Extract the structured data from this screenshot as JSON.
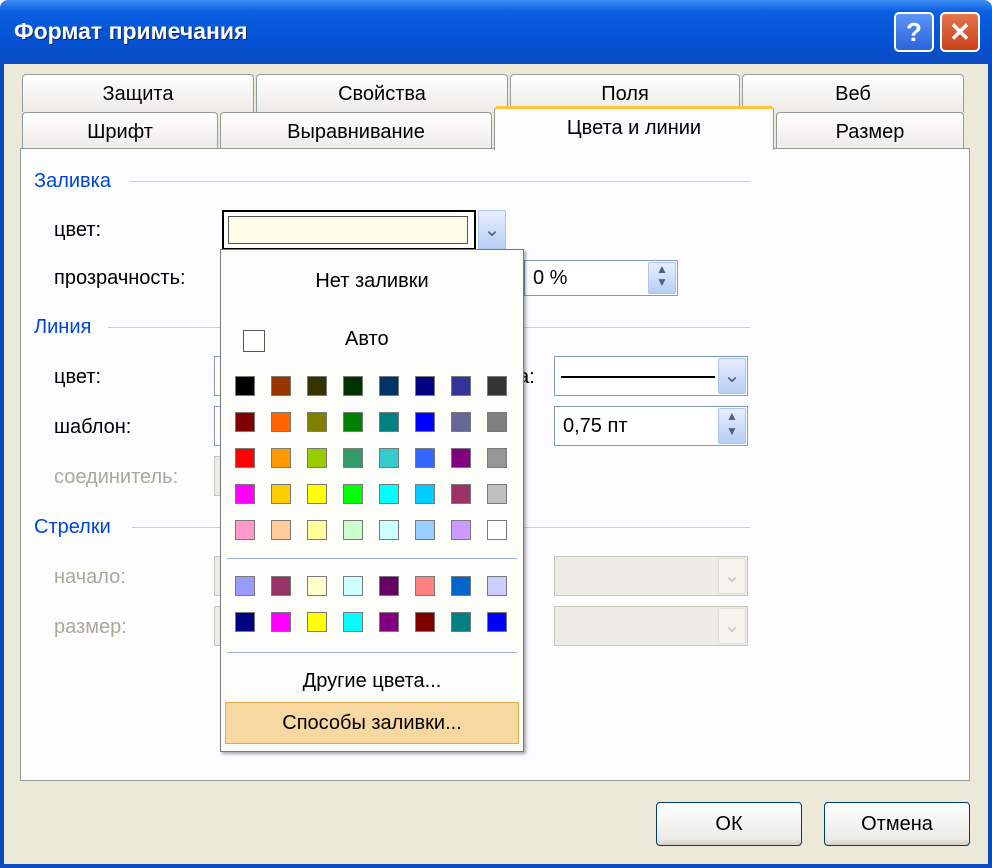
{
  "window": {
    "title": "Формат примечания",
    "help_symbol": "?",
    "close_symbol": "✕"
  },
  "tabs": {
    "back": [
      "Защита",
      "Свойства",
      "Поля",
      "Веб"
    ],
    "front": [
      "Шрифт",
      "Выравнивание",
      "Цвета и линии",
      "Размер"
    ],
    "active": "Цвета и линии"
  },
  "fill": {
    "group": "Заливка",
    "color_label": "цвет:",
    "transparency_label": "прозрачность:",
    "transparency_value": "0 %",
    "color_value": "#fffde8"
  },
  "line": {
    "group": "Линия",
    "color_label": "цвет:",
    "pattern_label": "шаблон:",
    "connector_label": "соединитель:",
    "weight_value": "0,75 пт",
    "partial_label": "а:"
  },
  "arrows": {
    "group": "Стрелки",
    "begin_label": "начало:",
    "size_label": "размер:"
  },
  "popup": {
    "no_fill": "Нет заливки",
    "auto": "Авто",
    "main_colors": [
      [
        "#000000",
        "#993300",
        "#333300",
        "#003300",
        "#003366",
        "#000080",
        "#333399",
        "#333333"
      ],
      [
        "#800000",
        "#ff6600",
        "#808000",
        "#008000",
        "#008080",
        "#0000ff",
        "#666699",
        "#808080"
      ],
      [
        "#ff0000",
        "#ff9900",
        "#99cc00",
        "#339966",
        "#33cccc",
        "#3366ff",
        "#800080",
        "#969696"
      ],
      [
        "#ff00ff",
        "#ffcc00",
        "#ffff00",
        "#00ff00",
        "#00ffff",
        "#00ccff",
        "#993366",
        "#c0c0c0"
      ],
      [
        "#ff99cc",
        "#ffcc99",
        "#ffff99",
        "#ccffcc",
        "#ccffff",
        "#99ccff",
        "#cc99ff",
        "#ffffff"
      ]
    ],
    "extra_colors": [
      [
        "#9999ff",
        "#993366",
        "#ffffcc",
        "#ccffff",
        "#660066",
        "#ff8080",
        "#0066cc",
        "#ccccff"
      ],
      [
        "#000080",
        "#ff00ff",
        "#ffff00",
        "#00ffff",
        "#800080",
        "#800000",
        "#008080",
        "#0000ff"
      ]
    ],
    "more_colors": "Другие цвета...",
    "fill_effects": "Способы заливки..."
  },
  "buttons": {
    "ok": "ОК",
    "cancel": "Отмена"
  }
}
